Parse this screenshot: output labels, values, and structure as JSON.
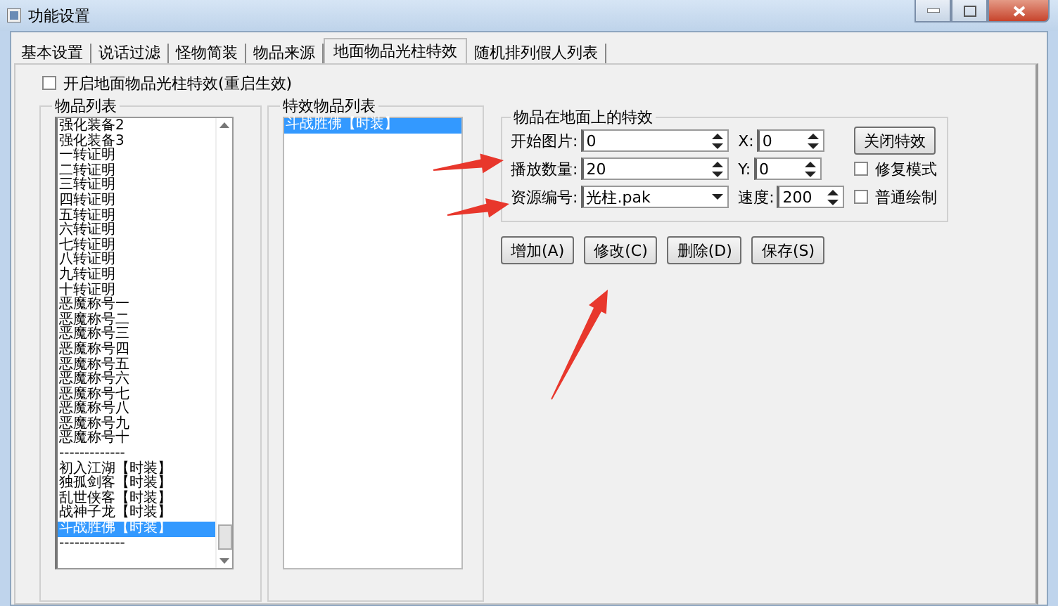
{
  "window": {
    "title": "功能设置"
  },
  "tabs": [
    {
      "label": "基本设置",
      "selected": false
    },
    {
      "label": "说话过滤",
      "selected": false
    },
    {
      "label": "怪物简装",
      "selected": false
    },
    {
      "label": "物品来源",
      "selected": false
    },
    {
      "label": "地面物品光柱特效",
      "selected": true
    },
    {
      "label": "随机排列假人列表",
      "selected": false
    }
  ],
  "enable_checkbox": {
    "label": "开启地面物品光柱特效(重启生效)",
    "checked": false
  },
  "item_list": {
    "title": "物品列表",
    "items": [
      {
        "label": "强化装备2",
        "selected": false
      },
      {
        "label": "强化装备3",
        "selected": false
      },
      {
        "label": "一转证明",
        "selected": false
      },
      {
        "label": "二转证明",
        "selected": false
      },
      {
        "label": "三转证明",
        "selected": false
      },
      {
        "label": "四转证明",
        "selected": false
      },
      {
        "label": "五转证明",
        "selected": false
      },
      {
        "label": "六转证明",
        "selected": false
      },
      {
        "label": "七转证明",
        "selected": false
      },
      {
        "label": "八转证明",
        "selected": false
      },
      {
        "label": "九转证明",
        "selected": false
      },
      {
        "label": "十转证明",
        "selected": false
      },
      {
        "label": "恶魔称号一",
        "selected": false
      },
      {
        "label": "恶魔称号二",
        "selected": false
      },
      {
        "label": "恶魔称号三",
        "selected": false
      },
      {
        "label": "恶魔称号四",
        "selected": false
      },
      {
        "label": "恶魔称号五",
        "selected": false
      },
      {
        "label": "恶魔称号六",
        "selected": false
      },
      {
        "label": "恶魔称号七",
        "selected": false
      },
      {
        "label": "恶魔称号八",
        "selected": false
      },
      {
        "label": "恶魔称号九",
        "selected": false
      },
      {
        "label": "恶魔称号十",
        "selected": false
      },
      {
        "label": "-------------",
        "selected": false
      },
      {
        "label": "初入江湖【时装】",
        "selected": false
      },
      {
        "label": "独孤剑客【时装】",
        "selected": false
      },
      {
        "label": "乱世侠客【时装】",
        "selected": false
      },
      {
        "label": "战神子龙【时装】",
        "selected": false
      },
      {
        "label": "斗战胜佛【时装】",
        "selected": true
      },
      {
        "label": "-------------",
        "selected": false
      }
    ]
  },
  "effect_list": {
    "title": "特效物品列表",
    "items": [
      {
        "label": "斗战胜佛【时装】",
        "selected": true
      }
    ]
  },
  "effect_group": {
    "title": "物品在地面上的特效",
    "rows": [
      [
        {
          "kind": "spinner",
          "label": "开始图片:",
          "value": "0"
        },
        {
          "kind": "spinner",
          "label": "X:",
          "value": "0"
        },
        {
          "kind": "button",
          "label": "关闭特效"
        }
      ],
      [
        {
          "kind": "spinner",
          "label": "播放数量:",
          "value": "20"
        },
        {
          "kind": "spinner",
          "label": "Y:",
          "value": "0"
        },
        {
          "kind": "checkbox",
          "label": "修复模式",
          "checked": false
        }
      ],
      [
        {
          "kind": "dropdown",
          "label": "资源编号:",
          "value": "光柱.pak"
        },
        {
          "kind": "spinner",
          "label": "速度:",
          "value": "200"
        },
        {
          "kind": "checkbox",
          "label": "普通绘制",
          "checked": false
        }
      ]
    ]
  },
  "buttons": [
    "增加(A)",
    "修改(C)",
    "删除(D)",
    "保存(S)"
  ]
}
